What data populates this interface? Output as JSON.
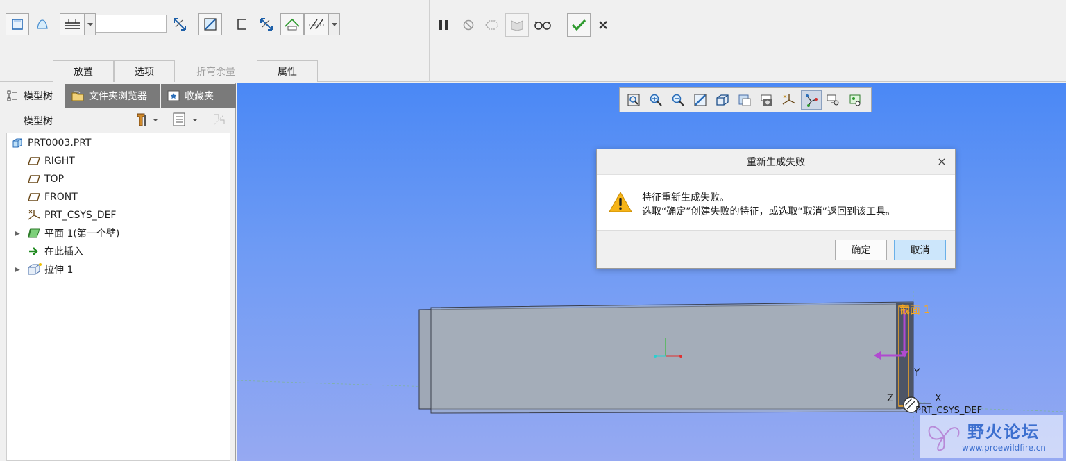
{
  "ribbon": {
    "tabs": [
      {
        "label": "放置",
        "enabled": true
      },
      {
        "label": "选项",
        "enabled": true
      },
      {
        "label": "折弯余量",
        "enabled": false
      },
      {
        "label": "属性",
        "enabled": true
      }
    ],
    "thickness_value": "",
    "icons": {
      "solid_button": "solid-extrude-icon",
      "surface_button": "surface-icon",
      "thickness_button": "thickness-icon",
      "flip_thickness": "flip-direction-icon",
      "remove_material": "remove-material-icon",
      "pause": "pause-icon",
      "no_preview": "no-preview-icon",
      "confirm": "check-icon",
      "cancel": "close-icon"
    }
  },
  "left_panel": {
    "tabs": [
      {
        "label": "模型树",
        "active": true
      },
      {
        "label": "文件夹浏览器",
        "active": false
      },
      {
        "label": "收藏夹",
        "active": false
      }
    ],
    "tree_title": "模型树",
    "tree_items": [
      {
        "label": "PRT0003.PRT",
        "icon": "part-icon",
        "level": 0,
        "expandable": false
      },
      {
        "label": "RIGHT",
        "icon": "datum-plane-icon",
        "level": 1,
        "expandable": false
      },
      {
        "label": "TOP",
        "icon": "datum-plane-icon",
        "level": 1,
        "expandable": false
      },
      {
        "label": "FRONT",
        "icon": "datum-plane-icon",
        "level": 1,
        "expandable": false
      },
      {
        "label": "PRT_CSYS_DEF",
        "icon": "csys-icon",
        "level": 1,
        "expandable": false
      },
      {
        "label": "平面 1(第一个壁)",
        "icon": "flat-wall-icon",
        "level": 1,
        "expandable": true
      },
      {
        "label": "在此插入",
        "icon": "insert-here-arrow-icon",
        "level": 1,
        "expandable": false
      },
      {
        "label": "拉伸 1",
        "icon": "extrude-icon",
        "level": 1,
        "expandable": true
      }
    ]
  },
  "viewport": {
    "labels": {
      "section": "截面 1",
      "axis_x": "X",
      "axis_y": "Y",
      "axis_z": "Z",
      "csys": "PRT_CSYS_DEF"
    }
  },
  "dialog": {
    "title": "重新生成失败",
    "close_glyph": "×",
    "message_line1": "特征重新生成失败。",
    "message_line2": "选取“确定”创建失败的特征，或选取“取消”返回到该工具。",
    "ok_label": "确定",
    "cancel_label": "取消"
  },
  "watermark": {
    "title": "野火论坛",
    "url": "www.proewildfire.cn"
  },
  "colors": {
    "accent_green": "#2e9a2e",
    "section_orange": "#f5a623",
    "viewport_top": "#4a88f5",
    "viewport_bottom": "#96a9f2"
  }
}
